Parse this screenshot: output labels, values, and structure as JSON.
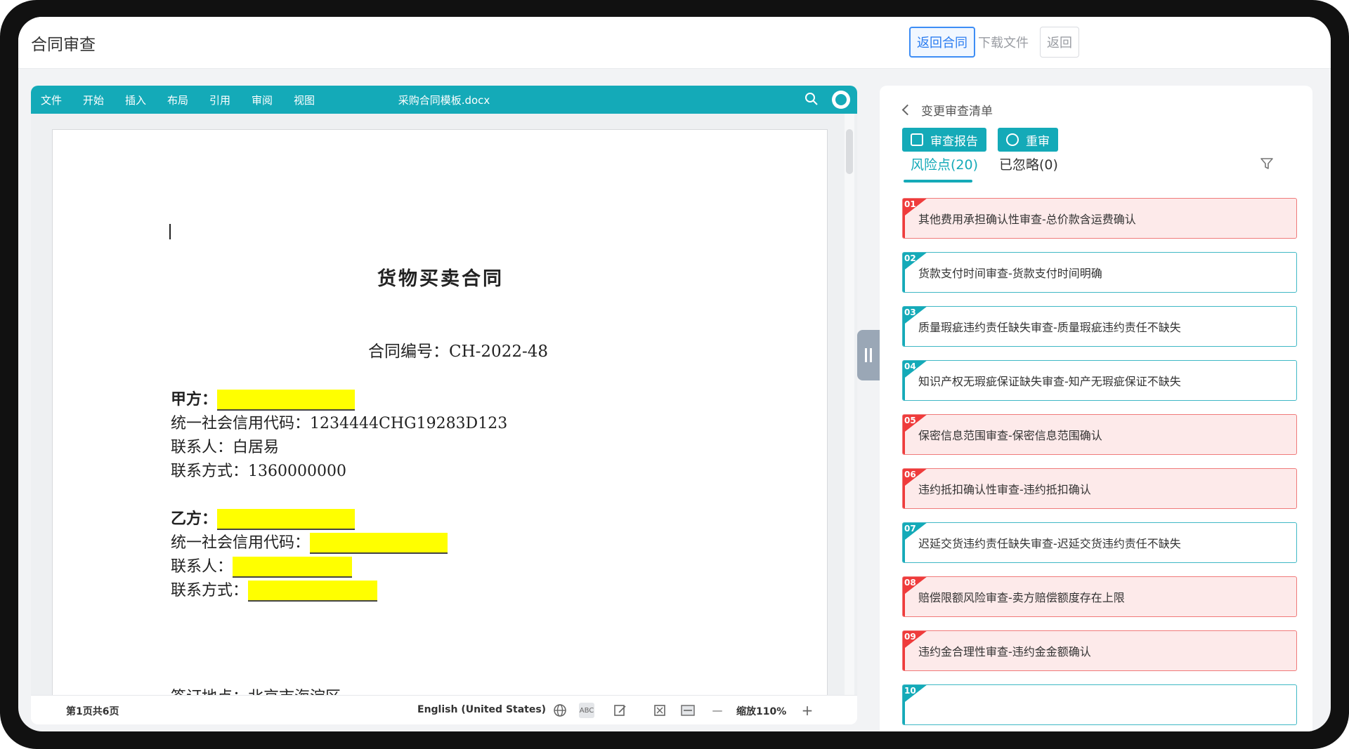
{
  "header": {
    "title": "合同审查",
    "buttons": {
      "back_contract": "返回合同",
      "download": "下载文件",
      "back": "返回"
    }
  },
  "editor": {
    "menu": [
      "文件",
      "开始",
      "插入",
      "布局",
      "引用",
      "审阅",
      "视图"
    ],
    "file_name": "采购合同模板.docx",
    "document": {
      "title": "货物买卖合同",
      "contract_no": "合同编号：CH-2022-48",
      "party_a_label": "甲方：",
      "party_a_credit": "统一社会信用代码：1234444CHG19283D123",
      "party_a_contact": "联系人：白居易",
      "party_a_phone": "联系方式：1360000000",
      "party_b_label": "乙方：",
      "party_b_credit": "统一社会信用代码：",
      "party_b_contact": "联系人：",
      "party_b_phone": "联系方式：",
      "sign_place": "签订地点：北京市海淀区"
    },
    "status": {
      "page_info": "第1页共6页",
      "language": "English (United States)",
      "zoom": "缩放110%"
    }
  },
  "review": {
    "back_label": "变更审查清单",
    "report_button": "审查报告",
    "rereview_button": "重审",
    "tabs": [
      "风险点(20)",
      "已忽略(0)"
    ],
    "risks": [
      {
        "num": "01",
        "text": "其他费用承担确认性审查-总价款含运费确认",
        "level": "red"
      },
      {
        "num": "02",
        "text": "货款支付时间审查-货款支付时间明确",
        "level": "teal"
      },
      {
        "num": "03",
        "text": "质量瑕疵违约责任缺失审查-质量瑕疵违约责任不缺失",
        "level": "teal"
      },
      {
        "num": "04",
        "text": "知识产权无瑕疵保证缺失审查-知产无瑕疵保证不缺失",
        "level": "teal"
      },
      {
        "num": "05",
        "text": "保密信息范围审查-保密信息范围确认",
        "level": "red"
      },
      {
        "num": "06",
        "text": "违约抵扣确认性审查-违约抵扣确认",
        "level": "red"
      },
      {
        "num": "07",
        "text": "迟延交货违约责任缺失审查-迟延交货违约责任不缺失",
        "level": "teal"
      },
      {
        "num": "08",
        "text": "赔偿限额风险审查-卖方赔偿额度存在上限",
        "level": "red"
      },
      {
        "num": "09",
        "text": "违约金合理性审查-违约金金额确认",
        "level": "red"
      },
      {
        "num": "10",
        "text": "",
        "level": "teal"
      }
    ]
  }
}
